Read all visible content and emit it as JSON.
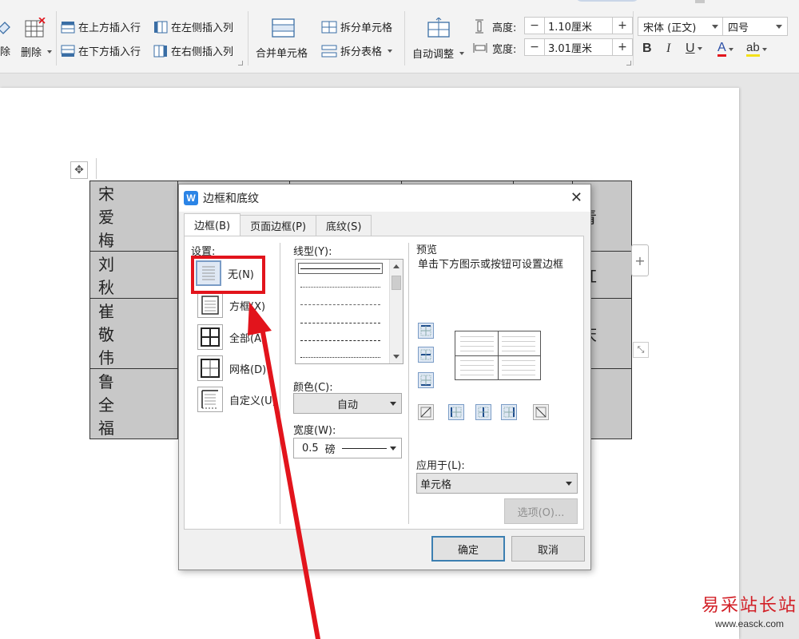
{
  "ribbon": {
    "delete_partial": "除",
    "delete_label": "删除",
    "insert_above": "在上方插入行",
    "insert_below": "在下方插入行",
    "insert_left": "在左侧插入列",
    "insert_right": "在右侧插入列",
    "merge_cells": "合并单元格",
    "split_cells": "拆分单元格",
    "split_table": "拆分表格",
    "auto_fit": "自动调整",
    "height_label": "高度:",
    "height_value": "1.10厘米",
    "width_label": "宽度:",
    "width_value": "3.01厘米",
    "minus": "−",
    "plus": "+",
    "font_name": "宋体 (正文)",
    "font_size": "四号",
    "bold": "B",
    "italic": "I",
    "underline": "U",
    "font_color": "A",
    "highlight": "ab"
  },
  "document": {
    "rows": [
      [
        "宋 爱 梅",
        "",
        "",
        "",
        "",
        "青"
      ],
      [
        "刘 秋",
        "",
        "",
        "",
        "",
        "红"
      ],
      [
        "崔 敬 伟",
        "",
        "",
        "",
        "",
        "庆"
      ],
      [
        "鲁 全 福",
        "",
        "",
        "",
        "",
        ""
      ]
    ],
    "add_column": "+"
  },
  "dialog": {
    "title": "边框和底纹",
    "close": "✕",
    "tabs": [
      "边框(B)",
      "页面边框(P)",
      "底纹(S)"
    ],
    "settings_label": "设置:",
    "settings": [
      {
        "label": "无(N)",
        "icon": "border-none-icon"
      },
      {
        "label": "方框(X)",
        "icon": "border-box-icon"
      },
      {
        "label": "全部(A)",
        "icon": "border-all-icon"
      },
      {
        "label": "网格(D)",
        "icon": "border-grid-icon"
      },
      {
        "label": "自定义(U)",
        "icon": "border-custom-icon"
      }
    ],
    "line_style_label": "线型(Y):",
    "color_label": "颜色(C):",
    "color_value": "自动",
    "width_label": "宽度(W):",
    "width_value": "0.5",
    "width_unit": "磅",
    "preview_label": "预览",
    "preview_hint": "单击下方图示或按钮可设置边框",
    "apply_label": "应用于(L):",
    "apply_value": "单元格",
    "options_button": "选项(O)...",
    "ok_button": "确定",
    "cancel_button": "取消"
  },
  "watermark": {
    "name": "易采站长站",
    "url": "www.easck.com"
  },
  "colors": {
    "annotation_red": "#e2141c",
    "selection_blue": "#7a9cc6",
    "table_fill": "#c8c8c8"
  }
}
